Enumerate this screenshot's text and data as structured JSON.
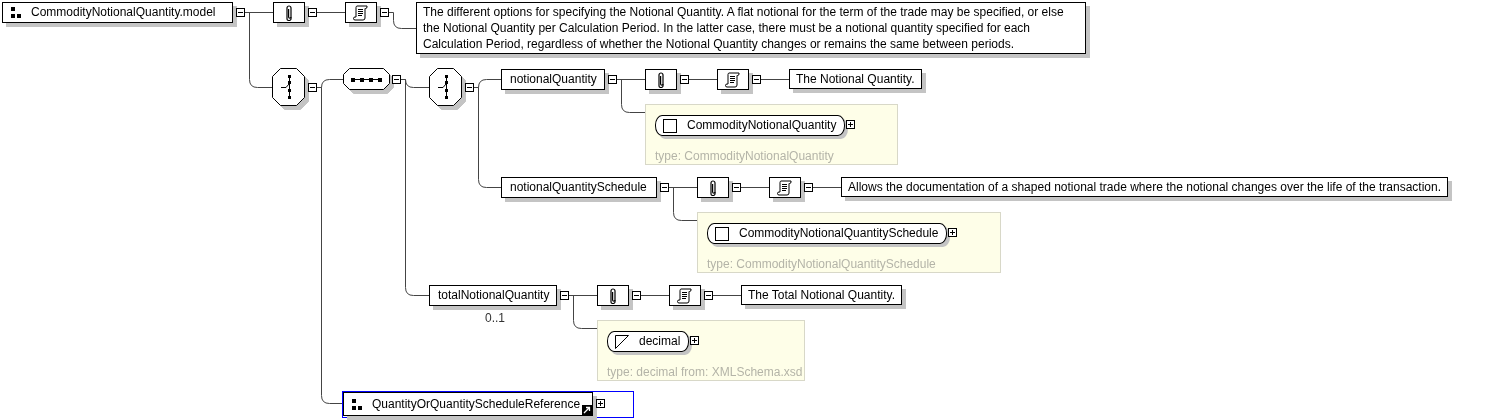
{
  "diagram": {
    "root": {
      "kind": "group",
      "label": "CommodityNotionalQuantity.model",
      "expanded": true,
      "annotation": {
        "expanded": true,
        "documentation": {
          "expanded": true,
          "text": "The different options for specifying the Notional Quantity. A flat notional for the term of the trade may be specified, or else the Notional Quantity per Calculation Period. In the latter case, there must be a notional quantity specified for each Calculation Period, regardless of whether the Notional Quantity changes or remains the same between periods."
        }
      },
      "children": [
        {
          "kind": "choice",
          "expanded": true,
          "children": [
            {
              "kind": "sequence",
              "expanded": true,
              "children": [
                {
                  "kind": "choice",
                  "expanded": true,
                  "children": [
                    {
                      "kind": "element",
                      "label": "notionalQuantity",
                      "expanded": true,
                      "annotation": {
                        "expanded": true,
                        "documentation": {
                          "expanded": true,
                          "text": "The Notional Quantity."
                        }
                      },
                      "type": {
                        "kind": "complex",
                        "name": "CommodityNotionalQuantity",
                        "expanded": false,
                        "caption": "type: CommodityNotionalQuantity"
                      }
                    },
                    {
                      "kind": "element",
                      "label": "notionalQuantitySchedule",
                      "expanded": true,
                      "annotation": {
                        "expanded": true,
                        "documentation": {
                          "expanded": true,
                          "text": "Allows the documentation of a shaped notional trade where the notional changes over the life of the transaction."
                        }
                      },
                      "type": {
                        "kind": "complex",
                        "name": "CommodityNotionalQuantitySchedule",
                        "expanded": false,
                        "caption": "type: CommodityNotionalQuantitySchedule"
                      }
                    }
                  ]
                },
                {
                  "kind": "element",
                  "label": "totalNotionalQuantity",
                  "occurs": "0..1",
                  "expanded": true,
                  "annotation": {
                    "expanded": true,
                    "documentation": {
                      "expanded": true,
                      "text": "The Total Notional Quantity."
                    }
                  },
                  "type": {
                    "kind": "simple",
                    "name": "decimal",
                    "expanded": false,
                    "caption": "type: decimal from: XMLSchema.xsd"
                  }
                }
              ]
            },
            {
              "kind": "group_ref",
              "label": "QuantityOrQuantityScheduleReference",
              "expanded": false,
              "selected": true
            }
          ]
        }
      ]
    }
  }
}
